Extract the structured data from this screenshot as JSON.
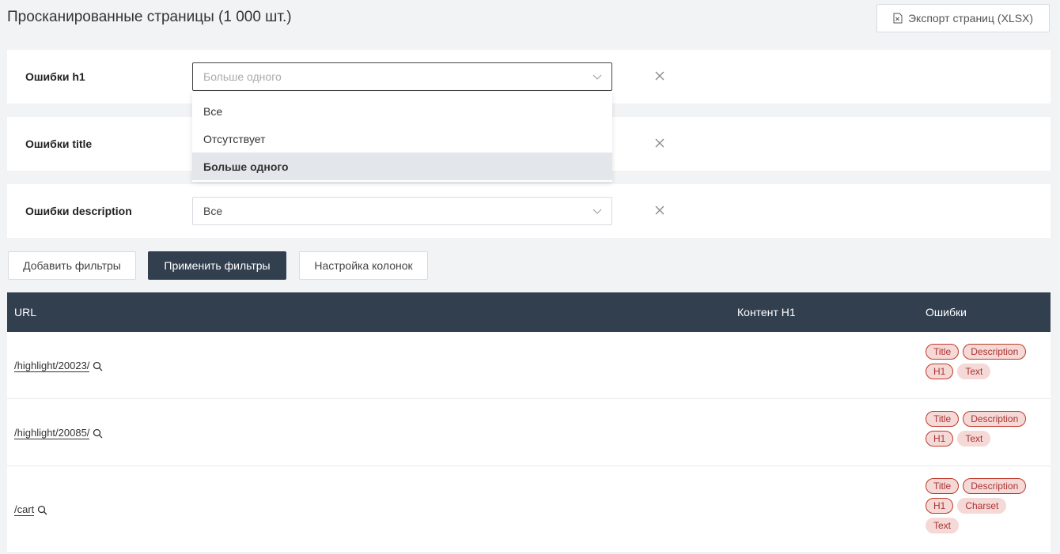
{
  "page": {
    "title": "Просканированные страницы (1 000 шт.)",
    "export_label": "Экспорт страниц (XLSX)"
  },
  "filters": [
    {
      "label": "Ошибки h1",
      "value": "Больше одного",
      "open": true
    },
    {
      "label": "Ошибки title",
      "value": ""
    },
    {
      "label": "Ошибки description",
      "value": "Все"
    }
  ],
  "dropdown": {
    "options": [
      "Все",
      "Отсутствует",
      "Больше одного"
    ],
    "selected": "Больше одного"
  },
  "actions": {
    "add": "Добавить фильтры",
    "apply": "Применить фильтры",
    "columns": "Настройка колонок"
  },
  "table": {
    "headers": {
      "url": "URL",
      "h1": "Контент H1",
      "errors": "Ошибки"
    },
    "rows": [
      {
        "url": "/highlight/20023/",
        "tags": [
          "Title",
          "Description",
          "H1",
          "Text"
        ]
      },
      {
        "url": "/highlight/20085/",
        "tags": [
          "Title",
          "Description",
          "H1",
          "Text"
        ]
      },
      {
        "url": "/cart",
        "tags": [
          "Title",
          "Description",
          "H1",
          "Charset",
          "Text"
        ]
      }
    ]
  },
  "colors": {
    "header_bg": "#323f4f",
    "tag_bg": "#f4d9d6",
    "tag_border": "#c0392b"
  }
}
